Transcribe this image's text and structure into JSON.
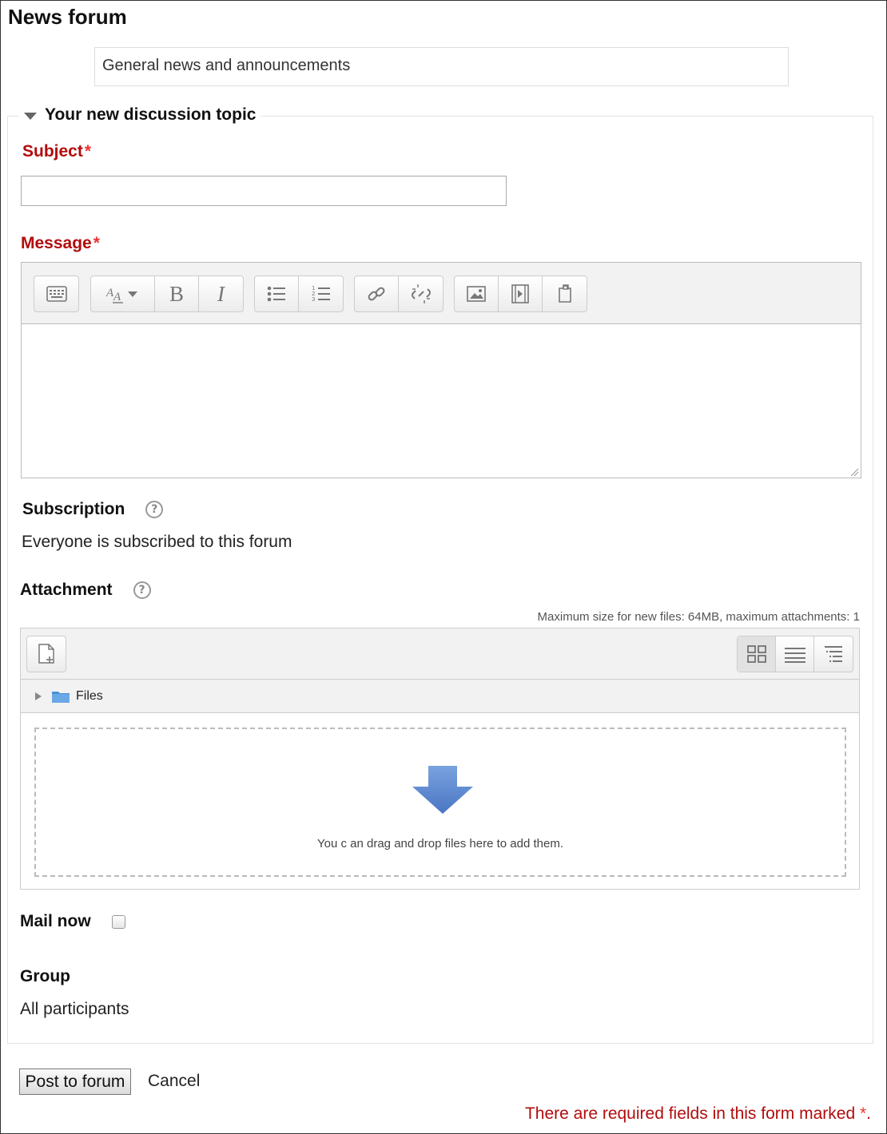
{
  "page": {
    "title": "News forum",
    "intro": "General news and announcements"
  },
  "form": {
    "legend": "Your new discussion topic",
    "subject": {
      "label": "Subject",
      "required_marker": "*",
      "value": ""
    },
    "message": {
      "label": "Message",
      "required_marker": "*",
      "value": ""
    },
    "editor_toolbar": {
      "groups": [
        [
          "toolbar-toggle-icon"
        ],
        [
          "font-style-icon",
          "bold-icon",
          "italic-icon"
        ],
        [
          "bullet-list-icon",
          "numbered-list-icon"
        ],
        [
          "link-icon",
          "unlink-icon"
        ],
        [
          "image-icon",
          "media-icon",
          "manage-files-icon"
        ]
      ],
      "bold_glyph": "B",
      "italic_glyph": "I"
    },
    "subscription": {
      "label": "Subscription",
      "help_glyph": "?",
      "value": "Everyone is subscribed to this forum"
    },
    "attachment": {
      "label": "Attachment",
      "help_glyph": "?",
      "max_size_note": "Maximum size for new files: 64MB, maximum attachments: 1",
      "folder_label": "Files",
      "drop_text": "You c an drag and drop files here to add them."
    },
    "mail_now": {
      "label": "Mail now",
      "checked": false
    },
    "group": {
      "label": "Group",
      "value": "All participants"
    },
    "submit_label": "Post to forum",
    "cancel_label": "Cancel",
    "required_note": "There are required fields in this form marked ",
    "required_note_star": "*",
    "required_note_end": "."
  },
  "colors": {
    "required": "#b20c0c",
    "star": "#e33333",
    "folder": "#4a90d9",
    "arrow": "#5b86cc"
  }
}
